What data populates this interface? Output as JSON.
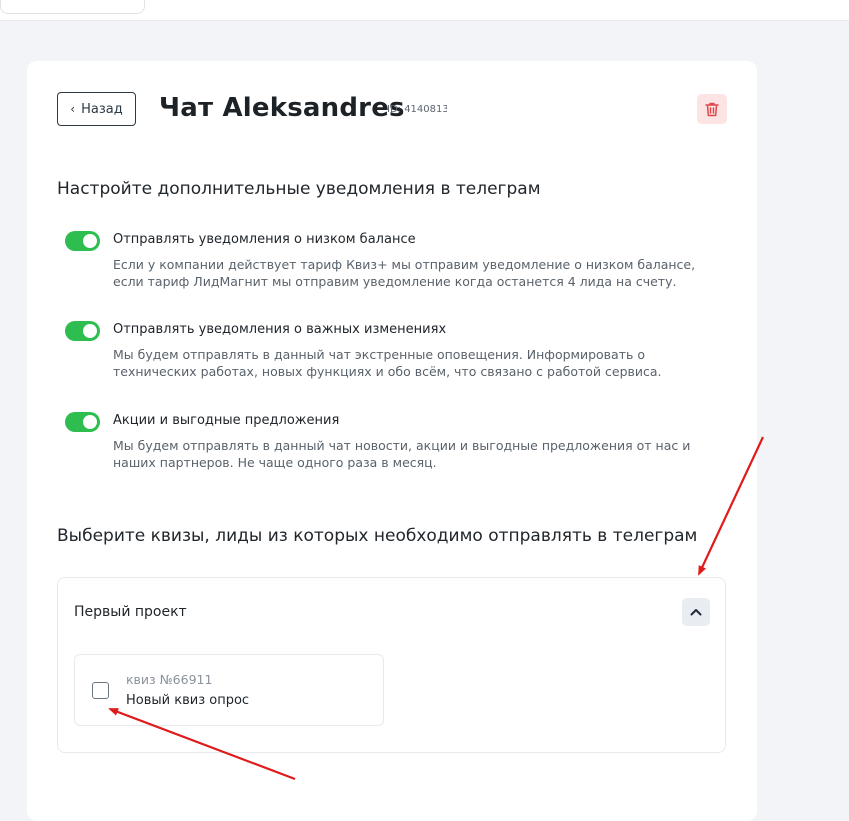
{
  "header": {
    "back_label": "Назад",
    "title": "Чат Aleksandres",
    "chat_id": "ID: 4140813"
  },
  "notifications": {
    "section_title": "Настройте дополнительные уведомления в телеграм",
    "items": [
      {
        "title": "Отправлять уведомления о низком балансе",
        "description": "Если у компании действует тариф Квиз+ мы отправим уведомление о низком балансе, если тариф ЛидМагнит мы отправим уведомление когда останется 4 лида на счету.",
        "enabled": true
      },
      {
        "title": "Отправлять уведомления о важных изменениях",
        "description": "Мы будем отправлять в данный чат экстренные оповещения. Информировать о технических работах, новых функциях и обо всём, что связано с работой сервиса.",
        "enabled": true
      },
      {
        "title": "Акции и выгодные предложения",
        "description": "Мы будем отправлять в данный чат новости, акции и выгодные предложения от нас и наших партнеров. Не чаще одного раза в месяц.",
        "enabled": true
      }
    ]
  },
  "quizzes": {
    "section_title": "Выберите квизы, лиды из которых необходимо отправлять в телеграм",
    "project": {
      "name": "Первый проект",
      "expanded": true,
      "items": [
        {
          "number": "квиз №66911",
          "name": "Новый квиз опрос",
          "checked": false
        }
      ]
    }
  },
  "colors": {
    "toggle_on": "#2ebd4f",
    "delete_bg": "#fde4e4",
    "delete_icon": "#e0474c",
    "annotation_arrow": "#e01b1b"
  }
}
